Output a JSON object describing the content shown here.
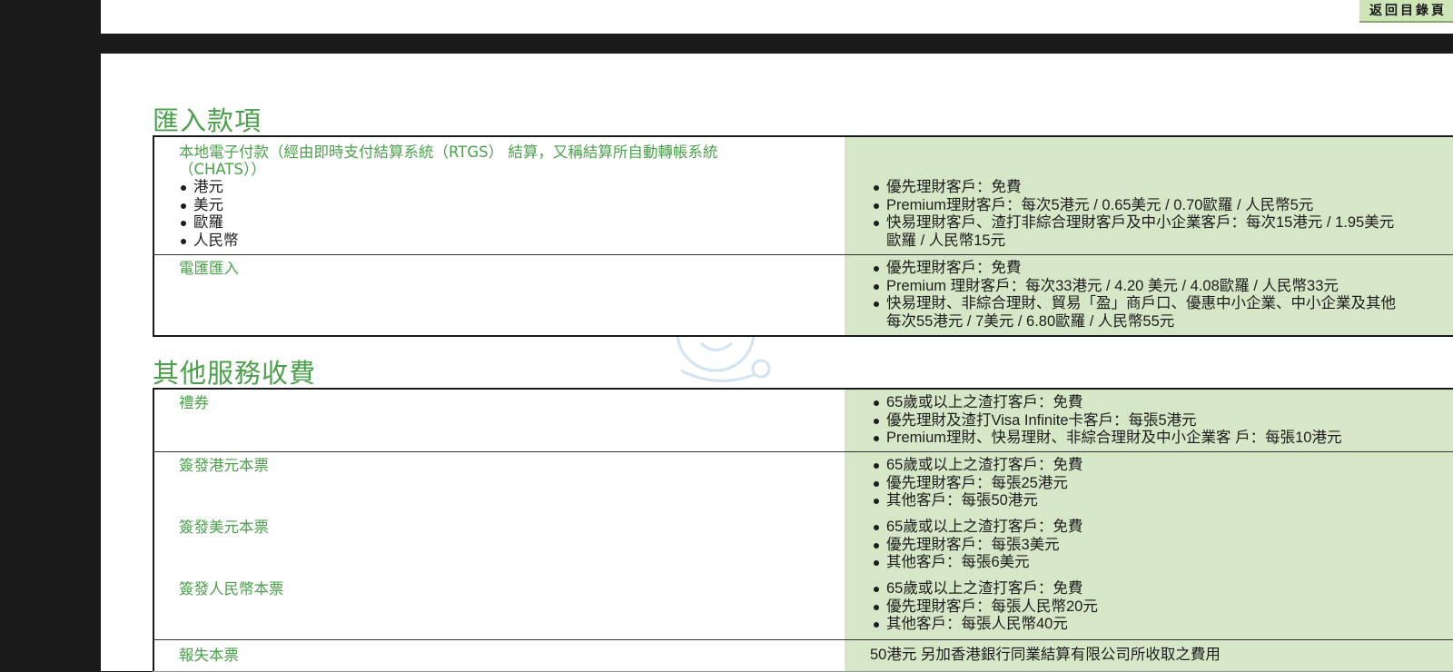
{
  "nav": {
    "back_label": "返回目錄頁"
  },
  "section1": {
    "title": "匯入款項",
    "rows": [
      {
        "label_lines": [
          "本地電子付款（經由即時支付結算系統（RTGS） 結算，又稱結算所自動轉帳系統",
          "（CHATS））"
        ],
        "currencies": [
          "港元",
          "美元",
          "歐羅",
          "人民幣"
        ],
        "fees": [
          "優先理財客戶：免費",
          "Premium理財客戶：每次5港元 / 0.65美元 / 0.70歐羅 / 人民幣5元",
          "快易理財客戶、渣打非綜合理財客戶及中小企業客戶：每次15港元 / 1.95美元"
        ],
        "fee_continuation": "歐羅 / 人民幣15元"
      },
      {
        "label": "電匯匯入",
        "fees": [
          "優先理財客戶：免費",
          "Premium 理財客戶：每次33港元 / 4.20 美元 / 4.08歐羅 / 人民幣33元",
          "快易理財、非綜合理財、貿易「盈」商戶口、優惠中小企業、中小企業及其他"
        ],
        "fee_continuation": "每次55港元 / 7美元 / 6.80歐羅 / 人民幣55元"
      }
    ]
  },
  "section2": {
    "title": "其他服務收費",
    "rows": [
      {
        "label": "禮券",
        "fees": [
          "65歲或以上之渣打客戶：免費",
          "優先理財及渣打Visa Infinite卡客戶：每張5港元",
          "Premium理財、快易理財、非綜合理財及中小企業客 戶：每張10港元"
        ]
      },
      {
        "label": "簽發港元本票",
        "fees": [
          "65歲或以上之渣打客戶：免費",
          "優先理財客戶：每張25港元",
          "其他客戶：每張50港元"
        ]
      },
      {
        "label": "簽發美元本票",
        "fees": [
          "65歲或以上之渣打客戶：免費",
          "優先理財客戶：每張3美元",
          "其他客戶：每張6美元"
        ]
      },
      {
        "label": "簽發人民幣本票",
        "fees": [
          "65歲或以上之渣打客戶：免費",
          "優先理財客戶：每張人民幣20元",
          "其他客戶：每張人民幣40元"
        ]
      },
      {
        "label": "報失本票",
        "fee_text": "50港元 另加香港銀行同業結算有限公司所收取之費用"
      }
    ]
  },
  "colors": {
    "accent_green": "#4aa14a",
    "fee_bg": "#d6e7c7",
    "button_bg": "#cfe5b8"
  }
}
